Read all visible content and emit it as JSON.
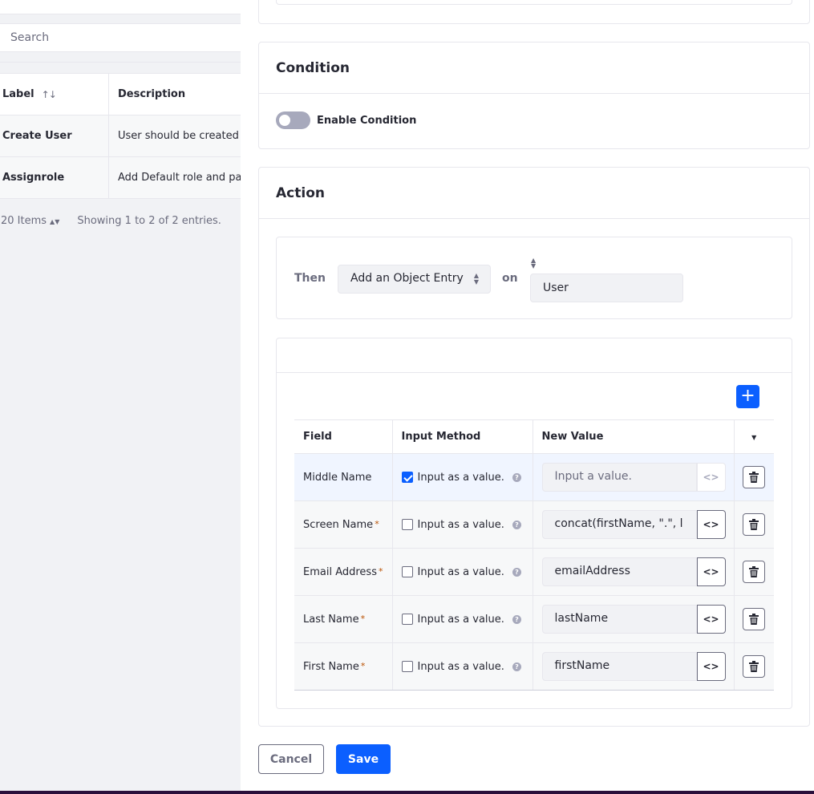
{
  "background": {
    "search_placeholder": "Search",
    "table": {
      "columns": [
        "Label",
        "Description"
      ],
      "sort_icon": "↑↓",
      "rows": [
        {
          "label": "Create User",
          "description": "User should be created w"
        },
        {
          "label": "Assignrole",
          "description": "Add Default role and pas"
        }
      ]
    },
    "pagination": {
      "items_per_page": "20 Items",
      "showing": "Showing 1 to 2 of 2 entries."
    }
  },
  "condition": {
    "title": "Condition",
    "toggle_label": "Enable Condition",
    "enabled": false
  },
  "action": {
    "title": "Action",
    "then_label": "Then",
    "action_select": "Add an Object Entry",
    "on_label": "on",
    "object_value": "User",
    "fields_table": {
      "columns": [
        "Field",
        "Input Method",
        "New Value"
      ],
      "rows": [
        {
          "field": "Middle Name",
          "required": false,
          "checked": true,
          "method": "Input as a value.",
          "value": "Input a value.",
          "is_placeholder": true
        },
        {
          "field": "Screen Name",
          "required": true,
          "checked": false,
          "method": "Input as a value.",
          "value": "concat(firstName, \".\", l",
          "is_placeholder": false
        },
        {
          "field": "Email Address",
          "required": true,
          "checked": false,
          "method": "Input as a value.",
          "value": "emailAddress",
          "is_placeholder": false
        },
        {
          "field": "Last Name",
          "required": true,
          "checked": false,
          "method": "Input as a value.",
          "value": "lastName",
          "is_placeholder": false
        },
        {
          "field": "First Name",
          "required": true,
          "checked": false,
          "method": "Input as a value.",
          "value": "firstName",
          "is_placeholder": false
        }
      ]
    }
  },
  "buttons": {
    "cancel": "Cancel",
    "save": "Save"
  },
  "colors": {
    "primary": "#0b5fff",
    "required": "#b95000",
    "panel_border": "#2a0f3b"
  },
  "icons": {
    "add": "plus-icon",
    "code": "code-icon",
    "delete": "trash-icon",
    "help": "help-icon",
    "column_menu": "caret-down-icon"
  }
}
